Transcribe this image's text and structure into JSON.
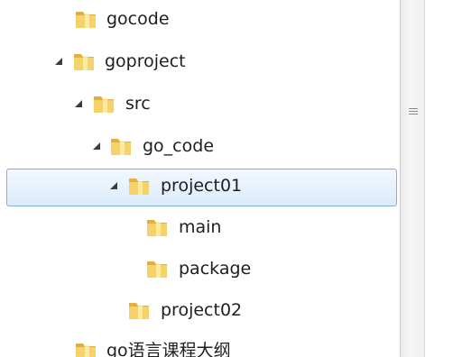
{
  "tree": {
    "items": [
      {
        "label": "gocode",
        "expanded": false,
        "selected": false
      },
      {
        "label": "goproject",
        "expanded": true,
        "selected": false
      },
      {
        "label": "src",
        "expanded": true,
        "selected": false
      },
      {
        "label": "go_code",
        "expanded": true,
        "selected": false
      },
      {
        "label": "project01",
        "expanded": true,
        "selected": true
      },
      {
        "label": "main",
        "expanded": false,
        "selected": false
      },
      {
        "label": "package",
        "expanded": false,
        "selected": false
      },
      {
        "label": "project02",
        "expanded": false,
        "selected": false
      },
      {
        "label": "go语言课程大纲",
        "expanded": false,
        "selected": false
      }
    ]
  },
  "icons": {
    "folder": "folder-icon",
    "expand": "expanded-arrow-icon",
    "grip": "splitter-grip-icon"
  },
  "colors": {
    "selection_border": "#84acdd",
    "selection_fill": "#dcebfb",
    "folder": "#f2c84b"
  }
}
